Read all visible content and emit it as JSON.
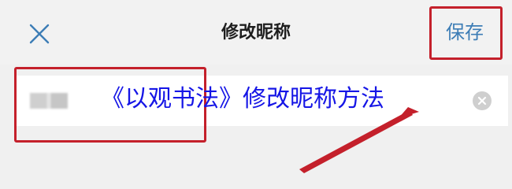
{
  "header": {
    "title": "修改昵称",
    "save_label": "保存",
    "close_icon": "close-icon"
  },
  "input": {
    "clear_icon": "clear-icon"
  },
  "caption": {
    "text": "《以观书法》修改昵称方法"
  },
  "colors": {
    "accent": "#3d7db6",
    "highlight": "#c4202b",
    "caption": "#1515e6"
  }
}
